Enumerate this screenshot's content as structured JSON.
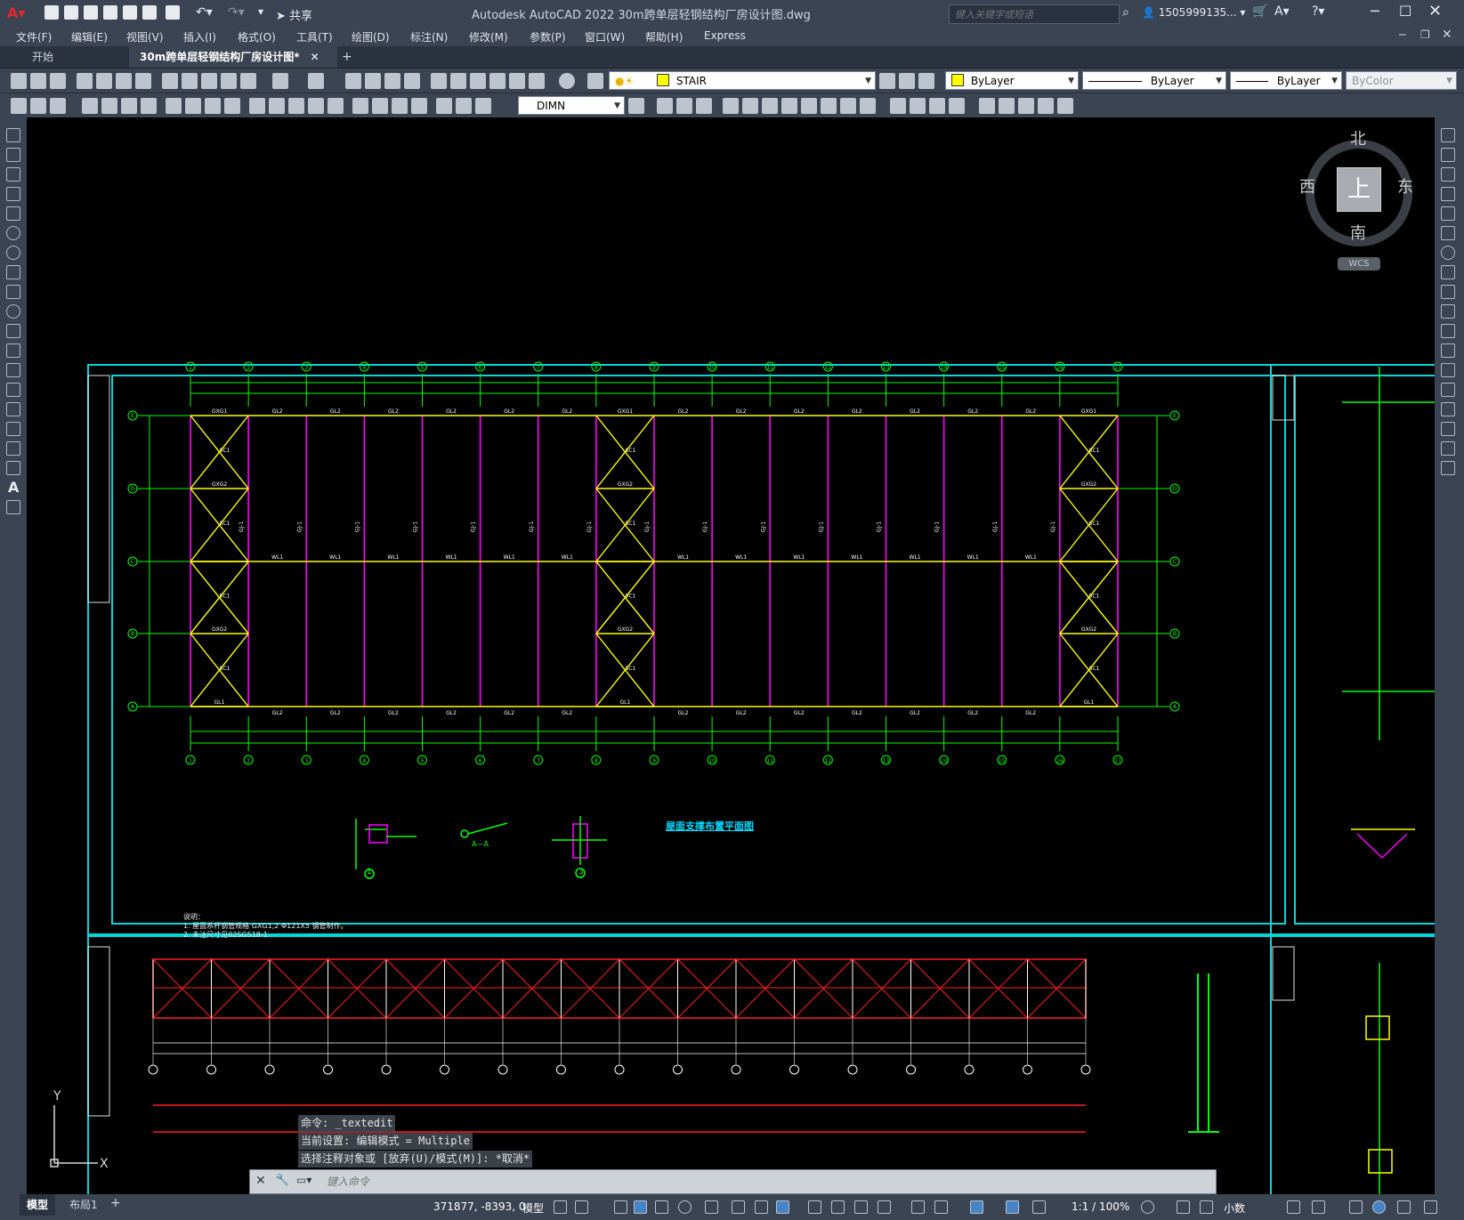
{
  "app": {
    "title": "Autodesk AutoCAD 2022    30m跨单层轻钢结构厂房设计图.dwg",
    "share_label": "共享",
    "search_placeholder": "键入关键字或短语",
    "user_label": "1505999135...",
    "window_controls": [
      "minimize",
      "maximize",
      "close"
    ]
  },
  "menus": [
    "文件(F)",
    "编辑(E)",
    "视图(V)",
    "插入(I)",
    "格式(O)",
    "工具(T)",
    "绘图(D)",
    "标注(N)",
    "修改(M)",
    "参数(P)",
    "窗口(W)",
    "帮助(H)",
    "Express"
  ],
  "tabs": [
    {
      "label": "开始",
      "active": false
    },
    {
      "label": "30m跨单层轻钢结构厂房设计图*",
      "active": true
    }
  ],
  "toolbar": {
    "layer_combo": "STAIR",
    "layer_color": "#ffff00",
    "color_combo": "ByLayer",
    "linetype_combo": "ByLayer",
    "lineweight_combo": "ByLayer",
    "plotstyle_combo": "ByColor",
    "dimstyle_combo": "DIMN"
  },
  "viewcube": {
    "north": "北",
    "south": "南",
    "east": "东",
    "west": "西",
    "face": "上",
    "wcs": "WCS"
  },
  "drawing": {
    "plan_title": "屋面支撑布置平面图",
    "axis_numbers": [
      "1",
      "2",
      "3",
      "4",
      "5",
      "6",
      "7",
      "8",
      "9",
      "10",
      "11",
      "12",
      "13",
      "14",
      "15",
      "16",
      "17"
    ],
    "axis_letters": [
      "E",
      "D",
      "C",
      "B",
      "A"
    ],
    "labels": {
      "gxg1": "GXG1",
      "gxg2": "GXG2",
      "gl1": "GL1",
      "gl2": "GL2",
      "wl1": "WL1",
      "sc1": "SC1",
      "gj1": "GJ-1"
    },
    "notes_title": "说明：",
    "notes": [
      "1. 屋面系杆钢管规格 GXG1,2 Φ121X5 钢管制作。",
      "2. 未注尺寸见02SG518-1"
    ],
    "detail_labels": [
      "1",
      "3",
      "A—A"
    ]
  },
  "command": {
    "history": [
      "命令: _textedit",
      "当前设置: 编辑模式 = Multiple",
      "选择注释对象或 [放弃(U)/模式(M)]: *取消*"
    ],
    "placeholder": "键入命令"
  },
  "status": {
    "layout_tabs": [
      "模型",
      "布局1"
    ],
    "coords": "371877, -8393, 0",
    "model_label": "模型",
    "scale": "1:1 / 100%",
    "units": "小数"
  },
  "colors": {
    "ui_bg": "#3b4453",
    "frame": "#00d8d8",
    "grid_axis": "#00ff00",
    "beam": "#ffff00",
    "column": "#ff00ff",
    "section": "#ff2020"
  }
}
